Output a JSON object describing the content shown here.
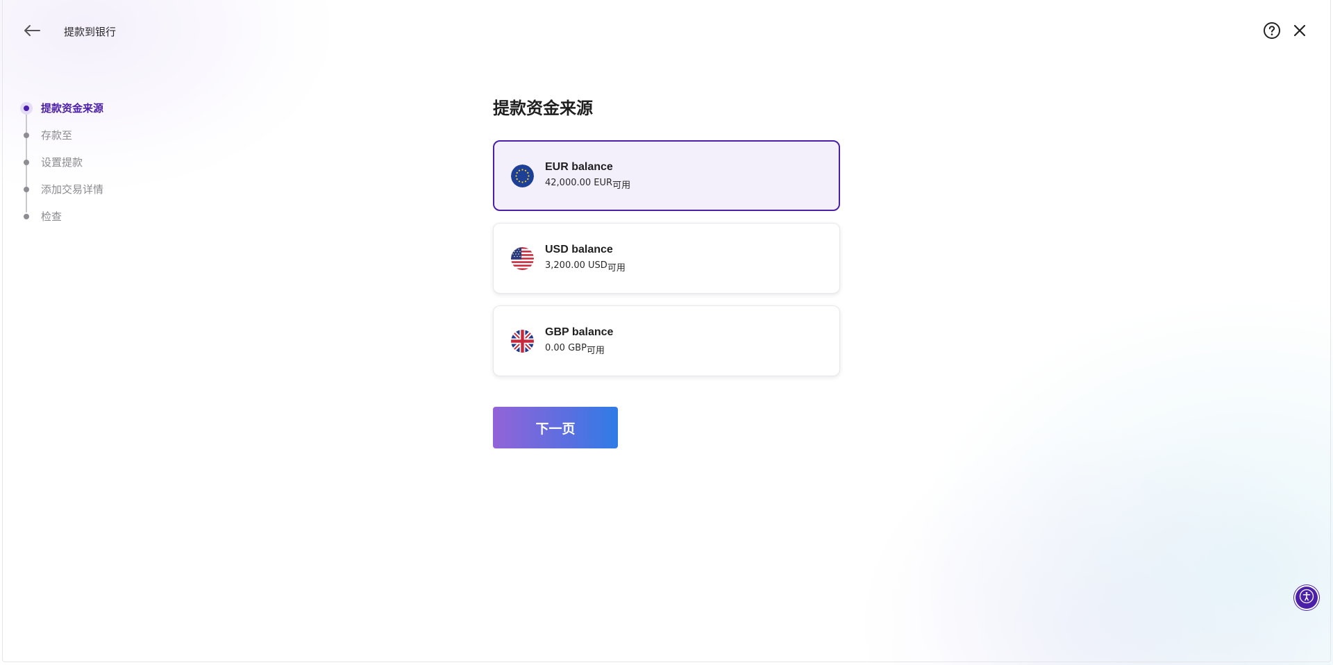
{
  "header": {
    "title": "提款到银行",
    "back_icon": "arrow-left-icon",
    "help_icon": "help-circle-icon",
    "close_icon": "close-icon"
  },
  "stepper": {
    "steps": [
      {
        "label": "提款资金来源",
        "active": true
      },
      {
        "label": "存款至",
        "active": false
      },
      {
        "label": "设置提款",
        "active": false
      },
      {
        "label": "添加交易详情",
        "active": false
      },
      {
        "label": "检查",
        "active": false
      }
    ]
  },
  "main": {
    "title": "提款资金来源",
    "balances": [
      {
        "name": "EUR balance",
        "amount": "42,000.00 EUR",
        "suffix": "可用",
        "flag": "eu-flag-icon",
        "selected": true
      },
      {
        "name": "USD balance",
        "amount": "3,200.00 USD",
        "suffix": "可用",
        "flag": "us-flag-icon",
        "selected": false
      },
      {
        "name": "GBP balance",
        "amount": "0.00 GBP",
        "suffix": "可用",
        "flag": "uk-flag-icon",
        "selected": false
      }
    ],
    "next_button": "下一页"
  },
  "accessibility_icon": "accessibility-icon",
  "colors": {
    "accent": "#4b1fa8",
    "selected_card_bg": "#f3effb",
    "button_gradient_start": "#9264d8",
    "button_gradient_end": "#2f7ce6"
  }
}
